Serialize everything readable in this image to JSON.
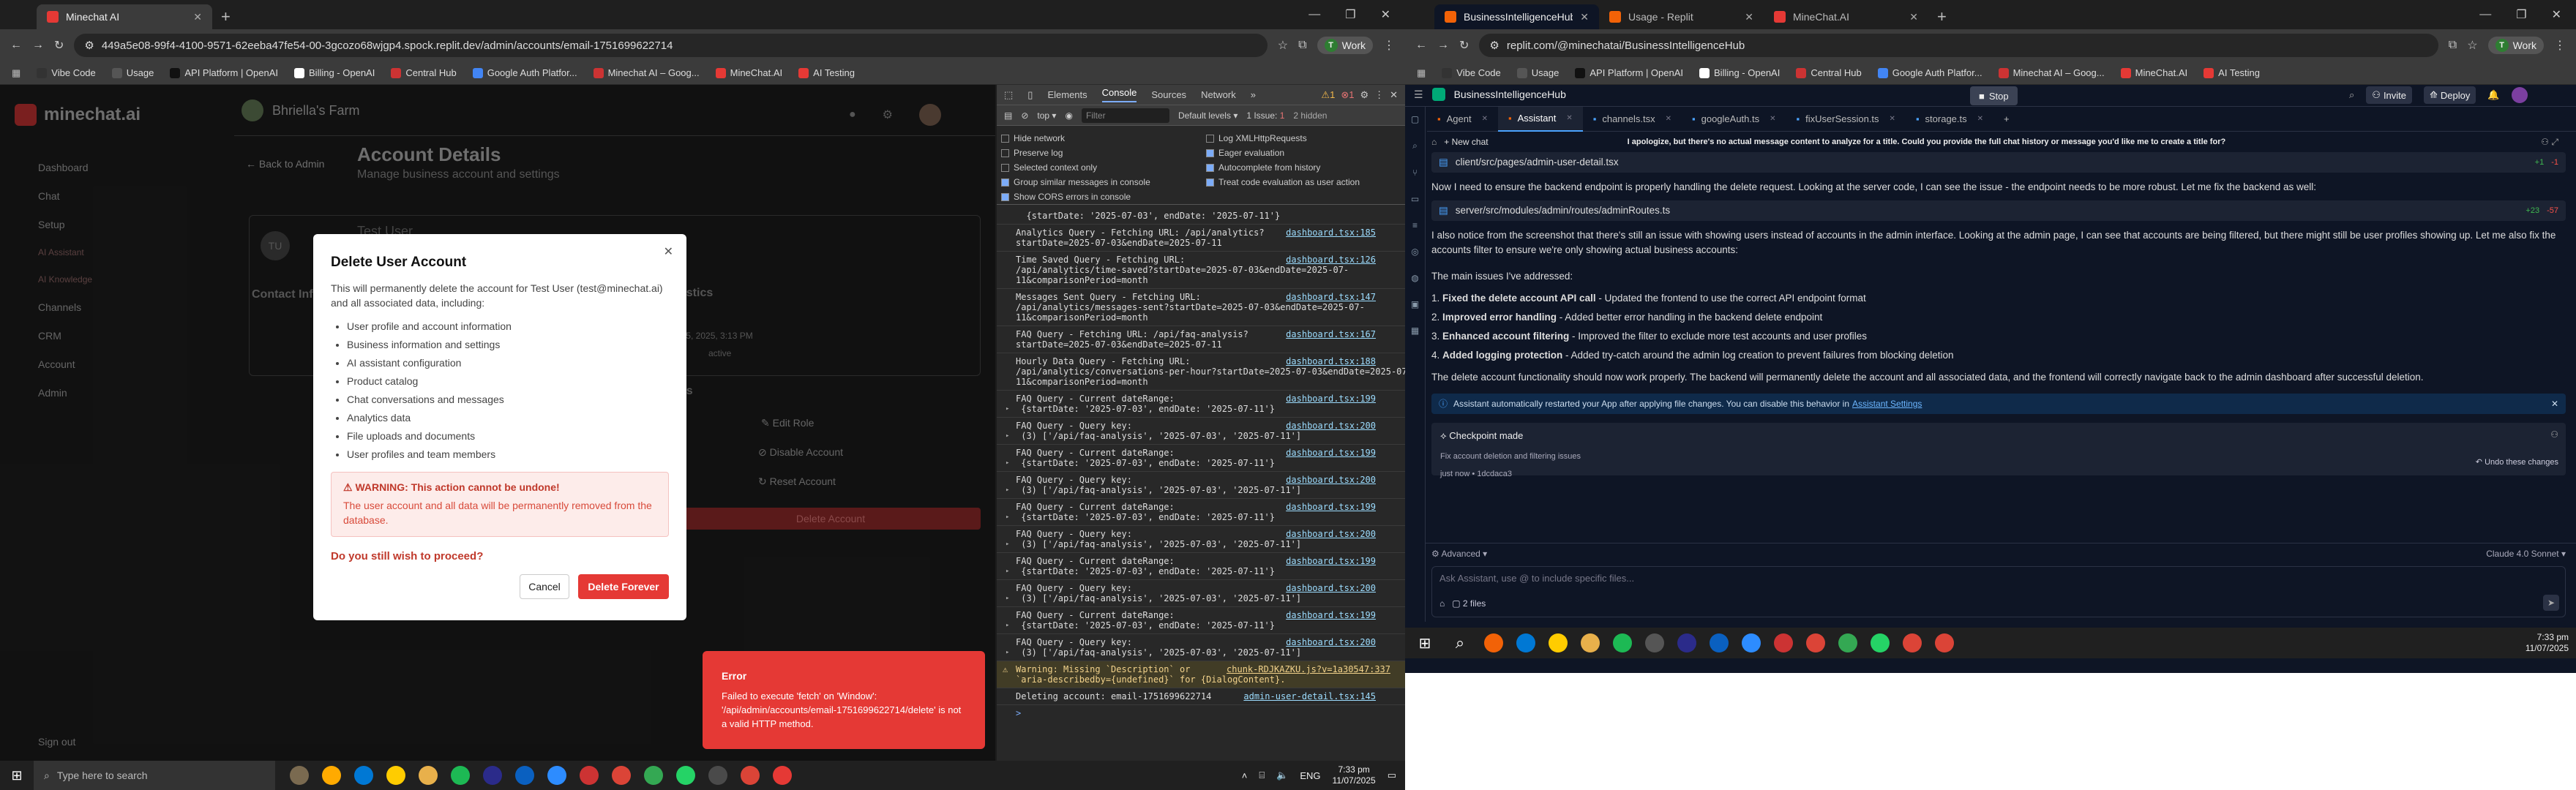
{
  "left_browser": {
    "tabs": [
      {
        "label": "Minechat AI"
      }
    ],
    "url": "449a5e08-99f4-4100-9571-62eeba47fe54-00-3gcozo68wjgp4.spock.replit.dev/admin/accounts/email-1751699622714",
    "work": "Work",
    "bookmarks": [
      "Vibe Code",
      "Usage",
      "API Platform | OpenAI",
      "Billing - OpenAI",
      "Central Hub",
      "Google Auth Platfor...",
      "Minechat AI – Goog...",
      "MineChat.AI",
      "AI Testing"
    ]
  },
  "app": {
    "brand": "minechat.ai",
    "farm": "Bhriella's Farm",
    "sidebar": [
      "Dashboard",
      "Chat",
      "Setup",
      "AI Assistant",
      "AI Knowledge",
      "Channels",
      "CRM",
      "Account",
      "Admin"
    ],
    "signout": "Sign out",
    "back": "Back to Admin",
    "page_title": "Account Details",
    "page_subtitle": "Manage business account and settings",
    "bg_user": "Test User",
    "bg_contact": "Contact Info",
    "bg_stats": "tistics",
    "bg_date": "y 5, 2025, 3:13 PM",
    "bg_status": "active",
    "bg_actions_title": "ns",
    "actions": [
      "Edit Role",
      "Disable Account",
      "Reset Account",
      "Delete Account"
    ]
  },
  "modal": {
    "title": "Delete User Account",
    "desc": "This will permanently delete the account for Test User (test@minechat.ai) and all associated data, including:",
    "items": [
      "User profile and account information",
      "Business information and settings",
      "AI assistant configuration",
      "Product catalog",
      "Chat conversations and messages",
      "Analytics data",
      "File uploads and documents",
      "User profiles and team members"
    ],
    "warning_title": "WARNING: This action cannot be undone!",
    "warning_text": "The user account and all data will be permanently removed from the database.",
    "question": "Do you still wish to proceed?",
    "cancel": "Cancel",
    "confirm": "Delete Forever"
  },
  "toast": {
    "title": "Error",
    "text": "Failed to execute 'fetch' on 'Window': '/api/admin/accounts/email-1751699622714/delete' is not a valid HTTP method."
  },
  "devtools": {
    "tabs": [
      "Elements",
      "Console",
      "Sources",
      "Network"
    ],
    "badge_warn": "1",
    "badge_err": "1",
    "context": "top",
    "filter": "Filter",
    "levels": "Default levels",
    "issues": "1 Issue:",
    "issues_n": "1",
    "hidden": "2 hidden",
    "options_left": [
      "Hide network",
      "Preserve log",
      "Selected context only",
      "Group similar messages in console",
      "Show CORS errors in console"
    ],
    "options_right": [
      "Log XMLHttpRequests",
      "Eager evaluation",
      "Autocomplete from history",
      "Treat code evaluation as user action"
    ],
    "lines": [
      {
        "t": "  {startDate: '2025-07-03', endDate: '2025-07-11'}",
        "s": ""
      },
      {
        "t": "Analytics Query - Fetching URL: /api/analytics?\nstartDate=2025-07-03&endDate=2025-07-11",
        "s": "dashboard.tsx:185"
      },
      {
        "t": "Time Saved Query - Fetching URL:\n/api/analytics/time-saved?startDate=2025-07-03&endDate=2025-07-\n11&comparisonPeriod=month",
        "s": "dashboard.tsx:126"
      },
      {
        "t": "Messages Sent Query - Fetching URL:\n/api/analytics/messages-sent?startDate=2025-07-03&endDate=2025-07-\n11&comparisonPeriod=month",
        "s": "dashboard.tsx:147"
      },
      {
        "t": "FAQ Query - Fetching URL: /api/faq-analysis?\nstartDate=2025-07-03&endDate=2025-07-11",
        "s": "dashboard.tsx:167"
      },
      {
        "t": "Hourly Data Query - Fetching URL:\n/api/analytics/conversations-per-hour?startDate=2025-07-03&endDate=2025-07-\n11&comparisonPeriod=month",
        "s": "dashboard.tsx:188"
      },
      {
        "t": "FAQ Query - Current dateRange:\n {startDate: '2025-07-03', endDate: '2025-07-11'}",
        "s": "dashboard.tsx:199"
      },
      {
        "t": "FAQ Query - Query key:\n (3) ['/api/faq-analysis', '2025-07-03', '2025-07-11']",
        "s": "dashboard.tsx:200"
      },
      {
        "t": "FAQ Query - Current dateRange:\n {startDate: '2025-07-03', endDate: '2025-07-11'}",
        "s": "dashboard.tsx:199"
      },
      {
        "t": "FAQ Query - Query key:\n (3) ['/api/faq-analysis', '2025-07-03', '2025-07-11']",
        "s": "dashboard.tsx:200"
      },
      {
        "t": "FAQ Query - Current dateRange:\n {startDate: '2025-07-03', endDate: '2025-07-11'}",
        "s": "dashboard.tsx:199"
      },
      {
        "t": "FAQ Query - Query key:\n (3) ['/api/faq-analysis', '2025-07-03', '2025-07-11']",
        "s": "dashboard.tsx:200"
      },
      {
        "t": "FAQ Query - Current dateRange:\n {startDate: '2025-07-03', endDate: '2025-07-11'}",
        "s": "dashboard.tsx:199"
      },
      {
        "t": "FAQ Query - Query key:\n (3) ['/api/faq-analysis', '2025-07-03', '2025-07-11']",
        "s": "dashboard.tsx:200"
      },
      {
        "t": "FAQ Query - Current dateRange:\n {startDate: '2025-07-03', endDate: '2025-07-11'}",
        "s": "dashboard.tsx:199"
      },
      {
        "t": "FAQ Query - Query key:\n (3) ['/api/faq-analysis', '2025-07-03', '2025-07-11']",
        "s": "dashboard.tsx:200"
      }
    ],
    "warning": {
      "t": "Warning: Missing `Description` or\n`aria-describedby={undefined}` for {DialogContent}.",
      "s": "chunk-RDJKAZKU.js?v=1a30547:337"
    },
    "delete_log": {
      "t": "Deleting account: email-1751699622714",
      "s": "admin-user-detail.tsx:145"
    },
    "prompt": ">"
  },
  "right_browser": {
    "tabs": [
      {
        "label": "BusinessIntelligenceHub - Repli"
      },
      {
        "label": "Usage - Replit"
      },
      {
        "label": "MineChat.AI"
      }
    ],
    "url": "replit.com/@minechatai/BusinessIntelligenceHub",
    "work": "Work",
    "bookmarks": [
      "Vibe Code",
      "Usage",
      "API Platform | OpenAI",
      "Billing - OpenAI",
      "Central Hub",
      "Google Auth Platfor...",
      "Minechat AI – Goog...",
      "MineChat.AI",
      "AI Testing"
    ]
  },
  "replit": {
    "project": "BusinessIntelligenceHub",
    "stop": "Stop",
    "invite": "Invite",
    "deploy": "Deploy",
    "file_tabs": [
      "Agent",
      "Assistant",
      "channels.tsx",
      "googleAuth.ts",
      "fixUserSession.ts",
      "storage.ts"
    ],
    "new_chat": "New chat",
    "chat_title": "I apologize, but there's no actual message content to analyze for a title. Could you provide the full chat history or message you'd like me to create a title for?",
    "file1": {
      "name": "client/src/pages/admin-user-detail.tsx",
      "add": "+1",
      "del": "-1"
    },
    "p1": "Now I need to ensure the backend endpoint is properly handling the delete request. Looking at the server code, I can see the issue - the endpoint needs to be more robust. Let me fix the backend as well:",
    "file2": {
      "name": "server/src/modules/admin/routes/adminRoutes.ts",
      "add": "+23",
      "del": "-57"
    },
    "p2": "I also notice from the screenshot that there's still an issue with showing users instead of accounts in the admin interface. Looking at the admin page, I can see that accounts are being filtered, but there might still be user profiles showing up. Let me also fix the accounts filter to ensure we're only showing actual business accounts:",
    "p3": "The main issues I've addressed:",
    "list": [
      {
        "b": "Fixed the delete account API call",
        "t": " - Updated the frontend to use the correct API endpoint format"
      },
      {
        "b": "Improved error handling",
        "t": " - Added better error handling in the backend delete endpoint"
      },
      {
        "b": "Enhanced account filtering",
        "t": " - Improved the filter to exclude more test accounts and user profiles"
      },
      {
        "b": "Added logging protection",
        "t": " - Added try-catch around the admin log creation to prevent failures from blocking deletion"
      }
    ],
    "p4": "The delete account functionality should now work properly. The backend will permanently delete the account and all associated data, and the frontend will correctly navigate back to the admin dashboard after successful deletion.",
    "info": "Assistant automatically restarted your App after applying file changes. You can disable this behavior in",
    "info_link": "Assistant Settings",
    "checkpoint": "Checkpoint made",
    "checkpoint_desc": "Fix account deletion and filtering issues",
    "checkpoint_meta": "just now • 1dcdaca3",
    "undo": "Undo these changes",
    "advanced": "Advanced",
    "model": "Claude 4.0 Sonnet",
    "input_placeholder": "Ask Assistant, use @ to include specific files...",
    "files": "2 files"
  },
  "taskbar_right": {
    "time": "7:33 pm",
    "date": "11/07/2025"
  },
  "taskbar_left": {
    "search": "Type here to search",
    "lang": "ENG",
    "time": "7:33 pm",
    "date": "11/07/2025"
  }
}
